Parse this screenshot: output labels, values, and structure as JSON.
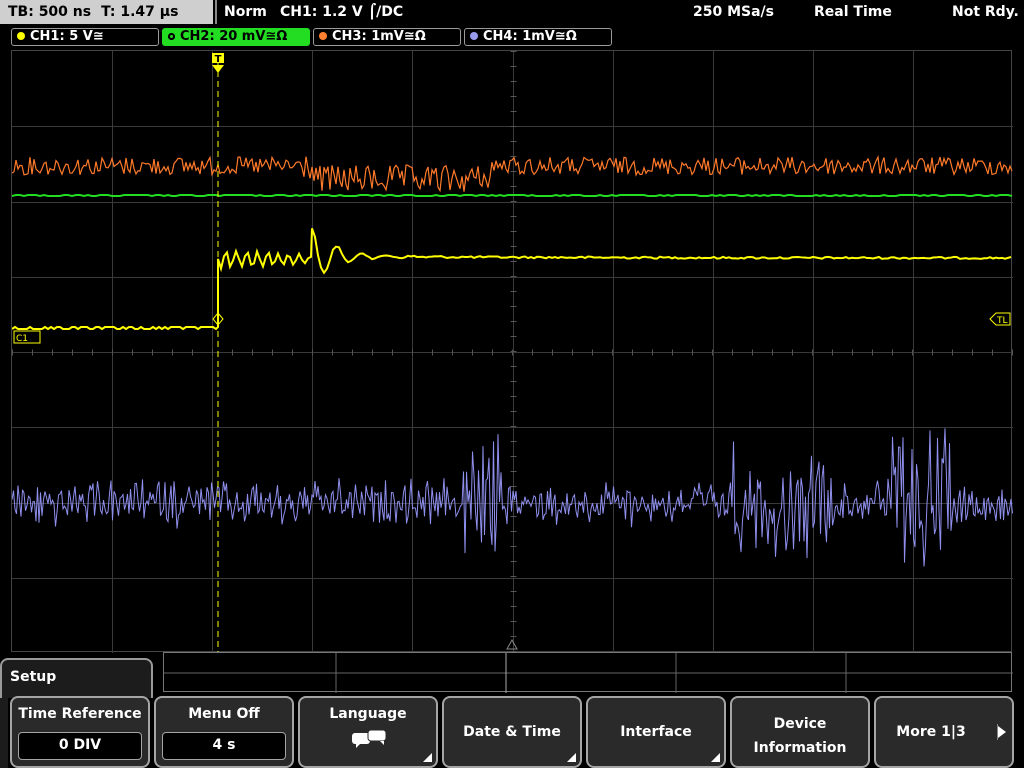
{
  "top_bar": {
    "timebase": "TB: 500 ns",
    "trigger_time": "T: 1.47 µs",
    "mode": "Norm",
    "trigger": "CH1: 1.2 V ⌠/DC",
    "sample_rate": "250 MSa/s",
    "acq_mode": "Real Time",
    "status": "Not Rdy."
  },
  "channels": [
    {
      "label": "CH1: 5 V≅",
      "color": "#ffff00",
      "active": false
    },
    {
      "label": "CH2: 20 mV≅Ω",
      "color": "#22dd22",
      "active": true
    },
    {
      "label": "CH3: 1mV≅Ω",
      "color": "#ff8030",
      "active": false
    },
    {
      "label": "CH4: 1mV≅Ω",
      "color": "#9999ee",
      "active": false
    }
  ],
  "markers": {
    "ch1": "C1",
    "trigger_level": "TL",
    "trigger_pos": "T"
  },
  "menu": {
    "title": "Setup",
    "softkeys": [
      {
        "label": "Time Reference",
        "value": "0 DIV"
      },
      {
        "label": "Menu Off",
        "value": "4 s"
      },
      {
        "label": "Language",
        "icon": "speech-bubbles-icon"
      },
      {
        "label": "Date & Time"
      },
      {
        "label": "Interface"
      },
      {
        "label": "Device Information"
      },
      {
        "label": "More 1|3"
      }
    ]
  }
}
